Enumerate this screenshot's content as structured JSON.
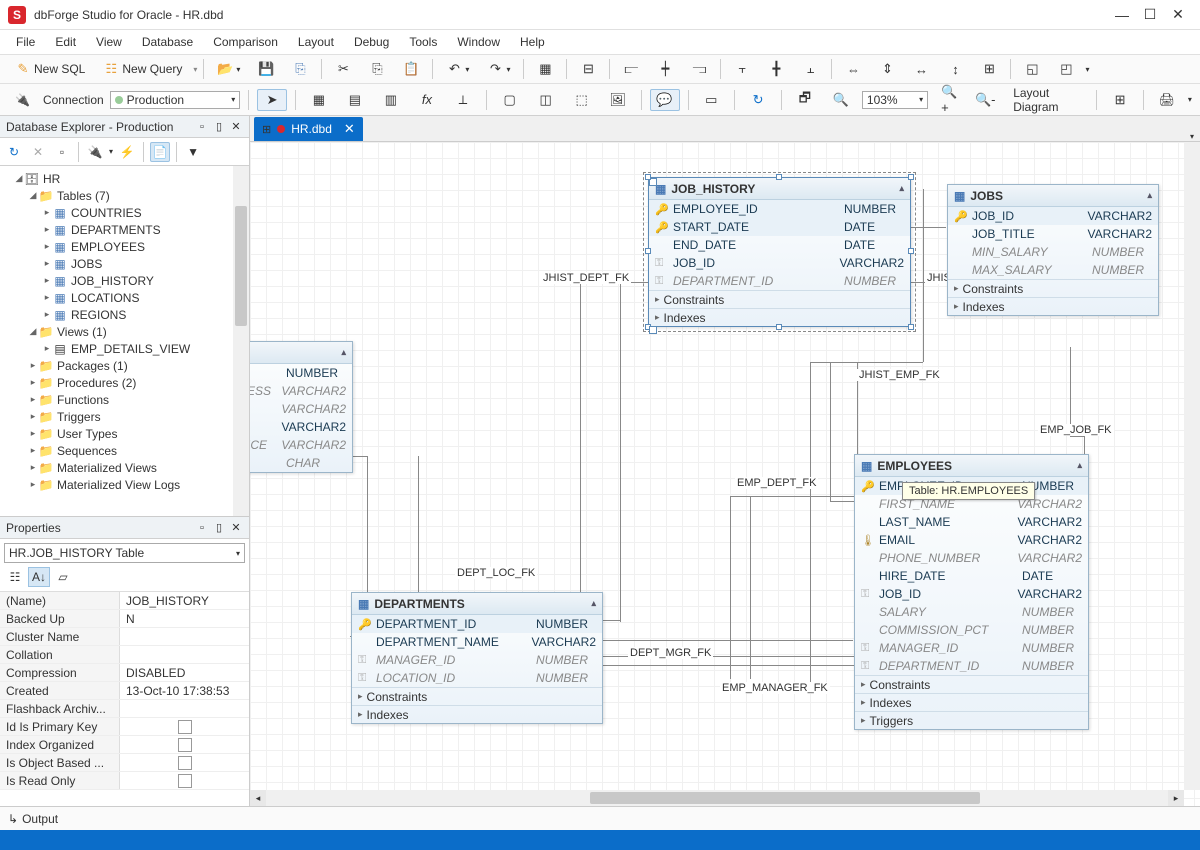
{
  "app": {
    "title": "dbForge Studio for Oracle - HR.dbd"
  },
  "menu": [
    "File",
    "Edit",
    "View",
    "Database",
    "Comparison",
    "Layout",
    "Debug",
    "Tools",
    "Window",
    "Help"
  ],
  "toolbar1": {
    "newsql": "New SQL",
    "newquery": "New Query"
  },
  "toolbar2": {
    "connection_label": "Connection",
    "connection_value": "Production",
    "zoom": "103%",
    "layout": "Layout Diagram"
  },
  "tab": {
    "label": "HR.dbd"
  },
  "explorer": {
    "title": "Database Explorer - Production",
    "root": "HR",
    "tables_label": "Tables (7)",
    "tables": [
      "COUNTRIES",
      "DEPARTMENTS",
      "EMPLOYEES",
      "JOBS",
      "JOB_HISTORY",
      "LOCATIONS",
      "REGIONS"
    ],
    "views_label": "Views (1)",
    "views": [
      "EMP_DETAILS_VIEW"
    ],
    "folders": [
      "Packages (1)",
      "Procedures (2)",
      "Functions",
      "Triggers",
      "User Types",
      "Sequences",
      "Materialized Views",
      "Materialized View Logs"
    ]
  },
  "properties": {
    "title": "Properties",
    "selector": "HR.JOB_HISTORY   Table",
    "rows": [
      {
        "k": "(Name)",
        "v": "JOB_HISTORY"
      },
      {
        "k": "Backed Up",
        "v": "N"
      },
      {
        "k": "Cluster Name",
        "v": ""
      },
      {
        "k": "Collation",
        "v": ""
      },
      {
        "k": "Compression",
        "v": "DISABLED"
      },
      {
        "k": "Created",
        "v": "13-Oct-10 17:38:53"
      },
      {
        "k": "Flashback Archiv...",
        "v": ""
      },
      {
        "k": "Id Is Primary Key",
        "v": "",
        "chk": true
      },
      {
        "k": "Index Organized",
        "v": "",
        "chk": true
      },
      {
        "k": "Is Object Based ...",
        "v": "",
        "chk": true
      },
      {
        "k": "Is Read Only",
        "v": "",
        "chk": true
      }
    ]
  },
  "tooltip": "Table: HR.EMPLOYEES",
  "entities": {
    "job_history": {
      "title": "JOB_HISTORY",
      "cols": [
        {
          "icon": "keys",
          "name": "EMPLOYEE_ID",
          "type": "NUMBER",
          "pk": true
        },
        {
          "icon": "key",
          "name": "START_DATE",
          "type": "DATE",
          "pk": true
        },
        {
          "icon": "",
          "name": "END_DATE",
          "type": "DATE"
        },
        {
          "icon": "fk",
          "name": "JOB_ID",
          "type": "VARCHAR2"
        },
        {
          "icon": "fk",
          "name": "DEPARTMENT_ID",
          "type": "NUMBER",
          "italic": true
        }
      ],
      "footer": [
        "Constraints",
        "Indexes"
      ]
    },
    "jobs": {
      "title": "JOBS",
      "cols": [
        {
          "icon": "key",
          "name": "JOB_ID",
          "type": "VARCHAR2",
          "pk": true
        },
        {
          "icon": "",
          "name": "JOB_TITLE",
          "type": "VARCHAR2"
        },
        {
          "icon": "",
          "name": "MIN_SALARY",
          "type": "NUMBER",
          "italic": true
        },
        {
          "icon": "",
          "name": "MAX_SALARY",
          "type": "NUMBER",
          "italic": true
        }
      ],
      "footer": [
        "Constraints",
        "Indexes"
      ]
    },
    "departments": {
      "title": "DEPARTMENTS",
      "cols": [
        {
          "icon": "key",
          "name": "DEPARTMENT_ID",
          "type": "NUMBER",
          "pk": true
        },
        {
          "icon": "",
          "name": "DEPARTMENT_NAME",
          "type": "VARCHAR2"
        },
        {
          "icon": "fk",
          "name": "MANAGER_ID",
          "type": "NUMBER",
          "italic": true
        },
        {
          "icon": "fk",
          "name": "LOCATION_ID",
          "type": "NUMBER",
          "italic": true
        }
      ],
      "footer": [
        "Constraints",
        "Indexes"
      ]
    },
    "employees": {
      "title": "EMPLOYEES",
      "cols": [
        {
          "icon": "key",
          "name": "EMPLOYEE_ID",
          "type": "NUMBER",
          "pk": true
        },
        {
          "icon": "",
          "name": "FIRST_NAME",
          "type": "VARCHAR2",
          "italic": true
        },
        {
          "icon": "",
          "name": "LAST_NAME",
          "type": "VARCHAR2"
        },
        {
          "icon": "temp",
          "name": "EMAIL",
          "type": "VARCHAR2"
        },
        {
          "icon": "",
          "name": "PHONE_NUMBER",
          "type": "VARCHAR2",
          "italic": true
        },
        {
          "icon": "",
          "name": "HIRE_DATE",
          "type": "DATE"
        },
        {
          "icon": "fk",
          "name": "JOB_ID",
          "type": "VARCHAR2"
        },
        {
          "icon": "",
          "name": "SALARY",
          "type": "NUMBER",
          "italic": true
        },
        {
          "icon": "",
          "name": "COMMISSION_PCT",
          "type": "NUMBER",
          "italic": true
        },
        {
          "icon": "fk",
          "name": "MANAGER_ID",
          "type": "NUMBER",
          "italic": true
        },
        {
          "icon": "fk",
          "name": "DEPARTMENT_ID",
          "type": "NUMBER",
          "italic": true
        }
      ],
      "footer": [
        "Constraints",
        "Indexes",
        "Triggers"
      ]
    },
    "fragment": {
      "cols": [
        {
          "name": "",
          "type": "NUMBER"
        },
        {
          "name": "ESS",
          "type": "VARCHAR2",
          "italic": true
        },
        {
          "name": "",
          "type": "VARCHAR2",
          "italic": true
        },
        {
          "name": "",
          "type": "VARCHAR2"
        },
        {
          "name": "ICE",
          "type": "VARCHAR2",
          "italic": true
        },
        {
          "name": "",
          "type": "CHAR",
          "italic": true
        }
      ]
    }
  },
  "fks": {
    "jhist_dept": "JHIST_DEPT_FK",
    "jhist_job": "JHIST_JOB_FK",
    "jhist_emp": "JHIST_EMP_FK",
    "dept_loc": "DEPT_LOC_FK",
    "dept_mgr": "DEPT_MGR_FK",
    "emp_dept": "EMP_DEPT_FK",
    "emp_job": "EMP_JOB_FK",
    "emp_manager": "EMP_MANAGER_FK"
  },
  "output": "Output"
}
